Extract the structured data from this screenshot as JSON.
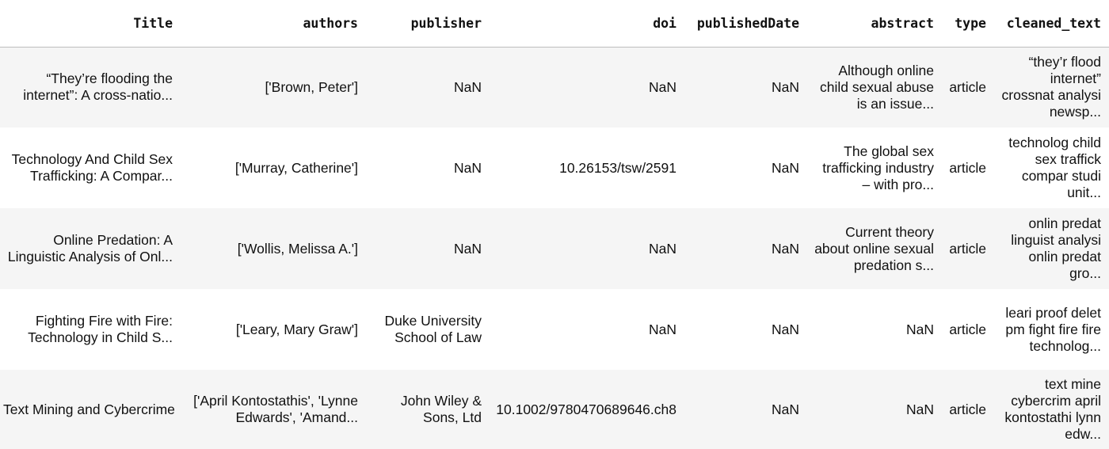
{
  "columns": [
    "Title",
    "authors",
    "publisher",
    "doi",
    "publishedDate",
    "abstract",
    "type",
    "cleaned_text"
  ],
  "rows": [
    {
      "title": [
        "“They’re flooding the",
        "internet”: A cross-natio..."
      ],
      "authors": [
        "['Brown, Peter']"
      ],
      "publisher": [
        "NaN"
      ],
      "doi": [
        "NaN"
      ],
      "publishedDate": [
        "NaN"
      ],
      "abstract": [
        "Although online",
        "child sexual abuse",
        "is an issue..."
      ],
      "type": [
        "article"
      ],
      "cleaned_text": [
        "“they’r flood",
        "internet”",
        "crossnat analysi",
        "newsp..."
      ]
    },
    {
      "title": [
        "Technology And Child Sex",
        "Trafficking: A Compar..."
      ],
      "authors": [
        "['Murray, Catherine']"
      ],
      "publisher": [
        "NaN"
      ],
      "doi": [
        "10.26153/tsw/2591"
      ],
      "publishedDate": [
        "NaN"
      ],
      "abstract": [
        "The global sex",
        "trafficking industry",
        "– with pro..."
      ],
      "type": [
        "article"
      ],
      "cleaned_text": [
        "technolog child",
        "sex traffick",
        "compar studi",
        "unit..."
      ]
    },
    {
      "title": [
        "Online Predation: A",
        "Linguistic Analysis of Onl..."
      ],
      "authors": [
        "['Wollis, Melissa A.']"
      ],
      "publisher": [
        "NaN"
      ],
      "doi": [
        "NaN"
      ],
      "publishedDate": [
        "NaN"
      ],
      "abstract": [
        "Current theory",
        "about online sexual",
        "predation s..."
      ],
      "type": [
        "article"
      ],
      "cleaned_text": [
        "onlin predat",
        "linguist analysi",
        "onlin predat",
        "gro..."
      ]
    },
    {
      "title": [
        "Fighting Fire with Fire:",
        "Technology in Child S..."
      ],
      "authors": [
        "['Leary, Mary Graw']"
      ],
      "publisher": [
        "Duke University",
        "School of Law"
      ],
      "doi": [
        "NaN"
      ],
      "publishedDate": [
        "NaN"
      ],
      "abstract": [
        "NaN"
      ],
      "type": [
        "article"
      ],
      "cleaned_text": [
        "leari proof delet",
        "pm fight fire fire",
        "technolog..."
      ]
    },
    {
      "title": [
        "Text Mining and Cybercrime"
      ],
      "authors": [
        "['April Kontostathis', 'Lynne",
        "Edwards', 'Amand..."
      ],
      "publisher": [
        "John Wiley &",
        "Sons, Ltd"
      ],
      "doi": [
        "10.1002/9780470689646.ch8"
      ],
      "publishedDate": [
        "NaN"
      ],
      "abstract": [
        "NaN"
      ],
      "type": [
        "article"
      ],
      "cleaned_text": [
        "text mine",
        "cybercrim april",
        "kontostathi lynn",
        "edw..."
      ]
    }
  ]
}
